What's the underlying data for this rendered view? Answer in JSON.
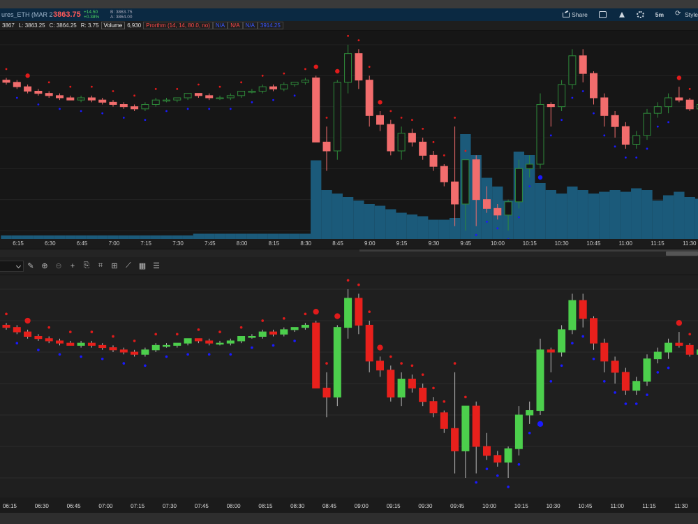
{
  "header": {
    "symbol": "ures_ETH (MAR 23)",
    "last_price": "3863.75",
    "change_abs": "+14.50",
    "change_pct": "+0.38%",
    "bid": "B: 3863.75",
    "ask": "A: 3864.00",
    "share_label": "Share",
    "interval_label": "5m",
    "style_label": "Style"
  },
  "status": {
    "high": "3867",
    "low": "L: 3863.25",
    "close": "C: 3864.25",
    "range": "R: 3.75",
    "volume_label": "Volume",
    "volume_value": "6,930",
    "indicator": "Prorthm (14, 14, 80.0, no)",
    "na1": "N/A",
    "na2": "N/A",
    "na3": "N/A",
    "val": "3914.25"
  },
  "colors": {
    "up_top": "#2e8b3a",
    "down_top": "#f26d6d",
    "up_bot": "#4ccf4c",
    "down_bot": "#e8201c",
    "volume": "#1b5a7a",
    "dot_red": "#e01b1b",
    "dot_blue": "#1a1aff"
  },
  "icons": [
    "share-icon",
    "bookmark-icon",
    "flask-icon",
    "gear-icon",
    "style-icon",
    "chevron-down-icon",
    "draw-icon",
    "zoom-in-icon",
    "zoom-out-icon",
    "crosshair-icon",
    "notes-icon",
    "fit-icon",
    "pattern-icon",
    "table-icon",
    "list-icon"
  ],
  "chart_data": [
    {
      "type": "candlestick",
      "panel": "top",
      "x_labels": [
        "6:15",
        "6:30",
        "6:45",
        "7:00",
        "7:15",
        "7:30",
        "7:45",
        "8:00",
        "8:15",
        "8:30",
        "8:45",
        "9:00",
        "9:15",
        "9:30",
        "9:45",
        "10:00",
        "10:15",
        "10:30",
        "10:45",
        "11:00",
        "11:15",
        "11:30"
      ],
      "candles_ohlc": [
        [
          3866,
          3867,
          3864,
          3865
        ],
        [
          3865,
          3866,
          3862,
          3863
        ],
        [
          3863,
          3864,
          3860,
          3861
        ],
        [
          3861,
          3862,
          3859,
          3860
        ],
        [
          3860,
          3861,
          3858,
          3859
        ],
        [
          3859,
          3860,
          3857,
          3858
        ],
        [
          3858,
          3859,
          3857,
          3857
        ],
        [
          3857,
          3859,
          3856,
          3858
        ],
        [
          3858,
          3859,
          3856,
          3857
        ],
        [
          3857,
          3858,
          3855,
          3856
        ],
        [
          3856,
          3857,
          3854,
          3855
        ],
        [
          3855,
          3856,
          3853,
          3854
        ],
        [
          3854,
          3855,
          3852,
          3853
        ],
        [
          3853,
          3856,
          3852,
          3855
        ],
        [
          3855,
          3858,
          3854,
          3857
        ],
        [
          3857,
          3858,
          3856,
          3857
        ],
        [
          3857,
          3858,
          3856,
          3858
        ],
        [
          3858,
          3860,
          3857,
          3860
        ],
        [
          3860,
          3860,
          3858,
          3859
        ],
        [
          3859,
          3860,
          3857,
          3858
        ],
        [
          3858,
          3859,
          3857,
          3858
        ],
        [
          3858,
          3860,
          3857,
          3859
        ],
        [
          3859,
          3861,
          3858,
          3861
        ],
        [
          3861,
          3862,
          3860,
          3861
        ],
        [
          3861,
          3864,
          3860,
          3863
        ],
        [
          3863,
          3864,
          3861,
          3862
        ],
        [
          3862,
          3865,
          3861,
          3864
        ],
        [
          3864,
          3865,
          3863,
          3865
        ],
        [
          3865,
          3867,
          3864,
          3866
        ],
        [
          3867,
          3868,
          3840,
          3838
        ],
        [
          3838,
          3845,
          3825,
          3834
        ],
        [
          3834,
          3866,
          3830,
          3865
        ],
        [
          3865,
          3882,
          3860,
          3878
        ],
        [
          3878,
          3880,
          3862,
          3866
        ],
        [
          3866,
          3868,
          3845,
          3850
        ],
        [
          3850,
          3852,
          3843,
          3846
        ],
        [
          3846,
          3848,
          3832,
          3834
        ],
        [
          3834,
          3845,
          3830,
          3842
        ],
        [
          3842,
          3844,
          3836,
          3838
        ],
        [
          3838,
          3840,
          3830,
          3832
        ],
        [
          3832,
          3834,
          3825,
          3827
        ],
        [
          3827,
          3828,
          3818,
          3820
        ],
        [
          3820,
          3845,
          3800,
          3810
        ],
        [
          3810,
          3830,
          3798,
          3830
        ],
        [
          3830,
          3832,
          3800,
          3812
        ],
        [
          3812,
          3818,
          3806,
          3808
        ],
        [
          3808,
          3810,
          3803,
          3805
        ],
        [
          3805,
          3812,
          3798,
          3811
        ],
        [
          3811,
          3830,
          3808,
          3826
        ],
        [
          3826,
          3832,
          3822,
          3828
        ],
        [
          3828,
          3860,
          3826,
          3855
        ],
        [
          3855,
          3856,
          3845,
          3854
        ],
        [
          3854,
          3866,
          3852,
          3864
        ],
        [
          3864,
          3880,
          3862,
          3877
        ],
        [
          3877,
          3880,
          3865,
          3869
        ],
        [
          3869,
          3870,
          3855,
          3858
        ],
        [
          3858,
          3860,
          3845,
          3850
        ],
        [
          3850,
          3852,
          3840,
          3845
        ],
        [
          3845,
          3847,
          3835,
          3837
        ],
        [
          3837,
          3843,
          3835,
          3841
        ],
        [
          3841,
          3853,
          3839,
          3851
        ],
        [
          3851,
          3856,
          3849,
          3854
        ],
        [
          3854,
          3860,
          3851,
          3858
        ],
        [
          3858,
          3863,
          3856,
          3857
        ],
        [
          3857,
          3858,
          3852,
          3853
        ],
        [
          3853,
          3856,
          3851,
          3855
        ],
        [
          3855,
          3866,
          3852,
          3864
        ]
      ],
      "volume": [
        2,
        2,
        2,
        2,
        2,
        2,
        2,
        2,
        2,
        2,
        2,
        2,
        2,
        2,
        2,
        2,
        2,
        2,
        3,
        3,
        3,
        3,
        3,
        3,
        3,
        3,
        3,
        3,
        3,
        45,
        28,
        26,
        24,
        22,
        20,
        19,
        17,
        15,
        14,
        13,
        11,
        11,
        12,
        60,
        48,
        35,
        30,
        22,
        50,
        48,
        32,
        28,
        26,
        30,
        28,
        26,
        27,
        28,
        27,
        29,
        28,
        22,
        25,
        27,
        24,
        23,
        24,
        21
      ]
    },
    {
      "type": "candlestick",
      "panel": "bottom",
      "x_labels": [
        "06:15",
        "06:30",
        "06:45",
        "07:00",
        "07:15",
        "07:30",
        "07:45",
        "08:00",
        "08:15",
        "08:30",
        "08:45",
        "09:00",
        "09:15",
        "09:30",
        "09:45",
        "10:00",
        "10:15",
        "10:30",
        "10:45",
        "11:00",
        "11:15",
        "11:30"
      ]
    }
  ]
}
